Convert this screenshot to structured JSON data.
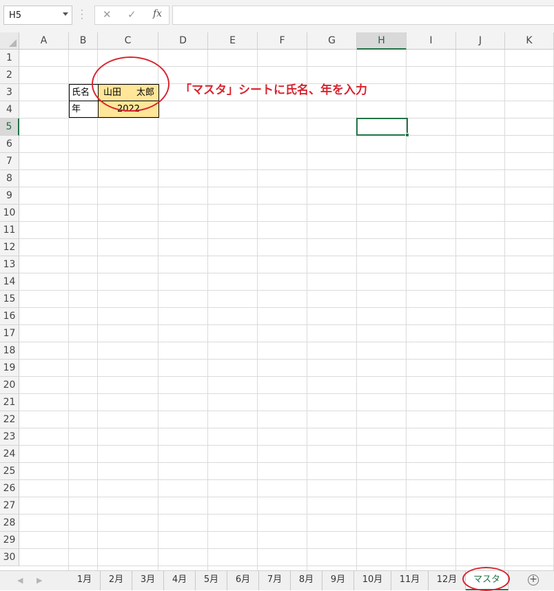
{
  "formula_bar": {
    "name_box": "H5",
    "cancel_glyph": "✕",
    "enter_glyph": "✓",
    "fx_label": "fx",
    "formula_value": ""
  },
  "columns": [
    "A",
    "B",
    "C",
    "D",
    "E",
    "F",
    "G",
    "H",
    "I",
    "J",
    "K"
  ],
  "active_column": "H",
  "rows": [
    "1",
    "2",
    "3",
    "4",
    "5",
    "6",
    "7",
    "8",
    "9",
    "10",
    "11",
    "12",
    "13",
    "14",
    "15",
    "16",
    "17",
    "18",
    "19",
    "20",
    "21",
    "22",
    "23",
    "24",
    "25",
    "26",
    "27",
    "28",
    "29",
    "30"
  ],
  "active_row": "5",
  "cells": {
    "B2": "氏名",
    "C2_family": "山田",
    "C2_given": "太郎",
    "B3": "年",
    "C3": "2022"
  },
  "annotation": "「マスタ」シートに氏名、年を入力",
  "colors": {
    "accent_green": "#217346",
    "annotation_red": "#d9242f",
    "input_fill": "#ffe699"
  },
  "sheet_tabs": [
    "1月",
    "2月",
    "3月",
    "4月",
    "5月",
    "6月",
    "7月",
    "8月",
    "9月",
    "10月",
    "11月",
    "12月",
    "マスタ"
  ],
  "active_tab": "マスタ",
  "icons": {
    "nav_prev": "◀",
    "nav_next": "▶",
    "add_sheet": "+"
  }
}
